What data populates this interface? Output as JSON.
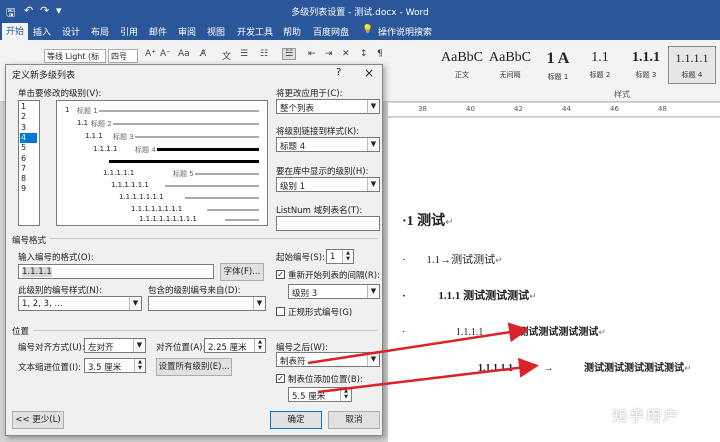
{
  "window": {
    "title": "多级列表设置 - 测试.docx  -  Word"
  },
  "ribbon": {
    "tabs": [
      "开始",
      "插入",
      "设计",
      "布局",
      "引用",
      "邮件",
      "审阅",
      "视图",
      "开发工具",
      "帮助",
      "百度网盘",
      "操作说明搜索"
    ],
    "font_name": "等线 Light (标",
    "font_size": "四号",
    "styles": [
      {
        "sample": "AaBbC",
        "name": "正文"
      },
      {
        "sample": "AaBbC",
        "name": "无间隔"
      },
      {
        "sample": "1 A",
        "name": "标题 1"
      },
      {
        "sample": "1.1",
        "name": "标题 2"
      },
      {
        "sample": "1.1.1",
        "name": "标题 3"
      },
      {
        "sample": "1.1.1.1",
        "name": "标题 4"
      }
    ],
    "group_label": "样式"
  },
  "dialog": {
    "title": "定义新多级列表",
    "help": "?",
    "close": "×",
    "level_label": "单击要修改的级别(V):",
    "levels": [
      "1",
      "2",
      "3",
      "4",
      "5",
      "6",
      "7",
      "8",
      "9"
    ],
    "selected_level": "4",
    "preview": [
      {
        "num": "1",
        "tag": "标题 1"
      },
      {
        "num": "1.1",
        "tag": "标题 2"
      },
      {
        "num": "1.1.1",
        "tag": "标题 3"
      },
      {
        "num": "1.1.1.1",
        "tag": "标题 4"
      },
      {
        "num": "1.1.1.1.1",
        "tag": "标题 5"
      },
      {
        "num": "1.1.1.1.1.1",
        "tag": ""
      },
      {
        "num": "1.1.1.1.1.1.1",
        "tag": ""
      },
      {
        "num": "1.1.1.1.1.1.1.1",
        "tag": ""
      },
      {
        "num": "1.1.1.1.1.1.1.1.1",
        "tag": ""
      }
    ],
    "apply_label": "将更改应用于(C):",
    "apply_value": "整个列表",
    "link_label": "将级别链接到样式(K):",
    "link_value": "标题 4",
    "gallery_label": "要在库中显示的级别(H):",
    "gallery_value": "级别 1",
    "listnum_label": "ListNum 域列表名(T):",
    "listnum_value": "",
    "format_section": "编号格式",
    "format_label": "输入编号的格式(O):",
    "format_value": "1.1.1.1",
    "font_button": "字体(F)...",
    "style_label": "此级别的编号样式(N):",
    "style_value": "1, 2, 3, ...",
    "include_label": "包含的级别编号来自(D):",
    "include_value": "",
    "start_label": "起始编号(S):",
    "start_value": "1",
    "restart_label": "重新开始列表的间隔(R):",
    "restart_checked": true,
    "restart_value": "级别 3",
    "legal_label": "正规形式编号(G)",
    "legal_checked": false,
    "position_section": "位置",
    "align_label": "编号对齐方式(U):",
    "align_value": "左对齐",
    "alignat_label": "对齐位置(A):",
    "alignat_value": "2.25 厘米",
    "indent_label": "文本缩进位置(I):",
    "indent_value": "3.5 厘米",
    "setall_button": "设置所有级别(E)...",
    "follow_label": "编号之后(W):",
    "follow_value": "制表符",
    "tabstop_label": "制表位添加位置(B):",
    "tabstop_checked": true,
    "tabstop_value": "5.5 厘米",
    "less_button": "<< 更少(L)",
    "ok_button": "确定",
    "cancel_button": "取消"
  },
  "document": {
    "lines": [
      {
        "bullet": "·",
        "num": "1",
        "text": "测试"
      },
      {
        "bullet": "·",
        "num": "1.1",
        "sep": "→",
        "text": "测试测试"
      },
      {
        "bullet": "·",
        "num": "1.1.1",
        "text": "测试测试测试"
      },
      {
        "bullet": "·",
        "num": "1.1.1.1",
        "sep": "→",
        "text": "测试测试测试测试"
      },
      {
        "bullet": "",
        "num": "1.1.1.1.1",
        "sep": "→",
        "text": "测试测试测试测试测试"
      }
    ]
  },
  "watermark": "知乎用户",
  "colors": {
    "accent": "#2b579a",
    "arrow": "#d9232b",
    "selection": "#0078d7"
  }
}
